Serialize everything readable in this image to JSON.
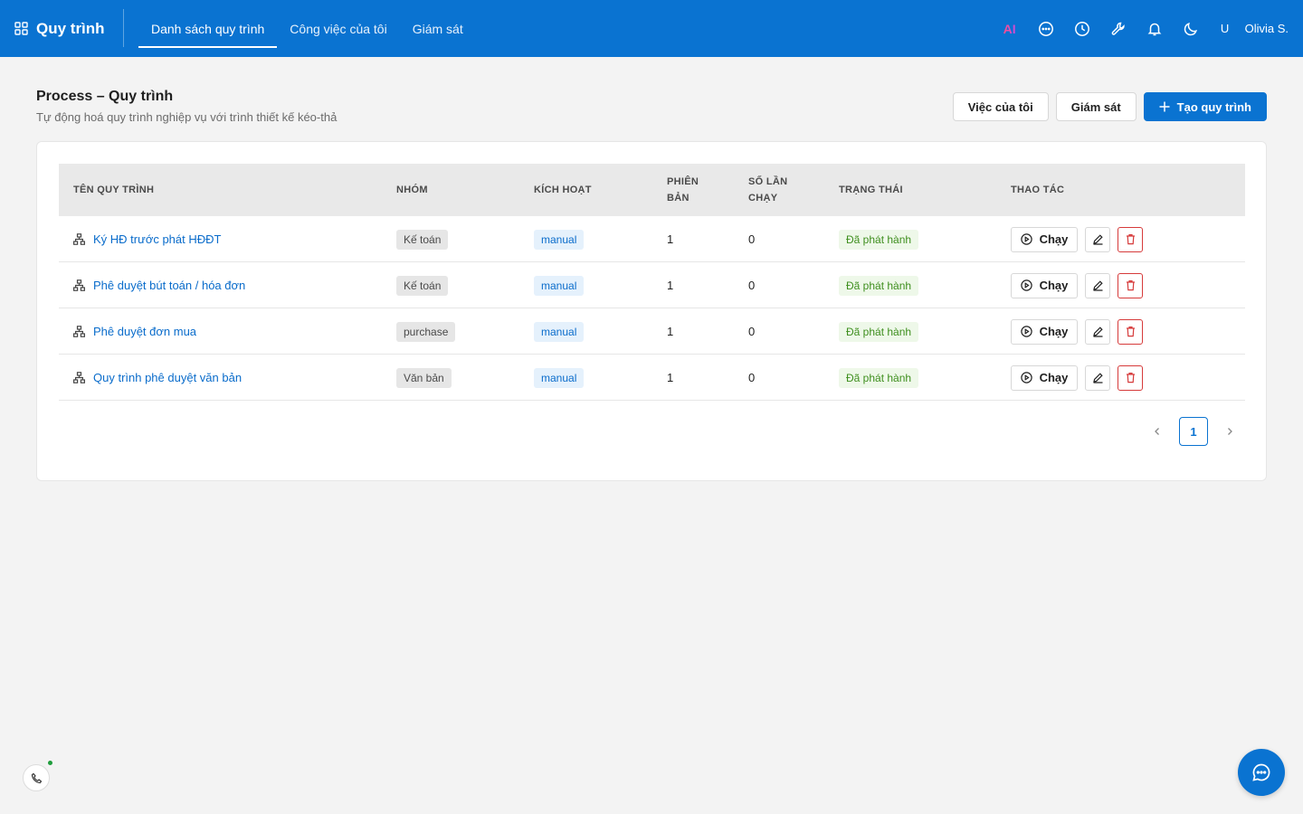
{
  "app": {
    "title": "Quy trình"
  },
  "nav": {
    "tabs": [
      {
        "label": "Danh sách quy trình",
        "active": true
      },
      {
        "label": "Công việc của tôi",
        "active": false
      },
      {
        "label": "Giám sát",
        "active": false
      }
    ]
  },
  "toolbar": {
    "ai_label": "AI",
    "icons": [
      "chat-icon",
      "history-icon",
      "tools-icon",
      "bell-icon",
      "moon-icon"
    ],
    "user_initial": "U",
    "user_name": "Olivia S."
  },
  "page": {
    "title": "Process – Quy trình",
    "subtitle": "Tự động hoá quy trình nghiệp vụ với trình thiết kế kéo-thả"
  },
  "actions": {
    "my_tasks": "Việc của tôi",
    "monitor": "Giám sát",
    "create": "Tạo quy trình"
  },
  "table": {
    "headers": {
      "name": "TÊN QUY TRÌNH",
      "group": "NHÓM",
      "trigger": "KÍCH HOẠT",
      "version_l1": "PHIÊN",
      "version_l2": "BẢN",
      "runs_l1": "SỐ LẦN",
      "runs_l2": "CHẠY",
      "status": "TRẠNG THÁI",
      "actions": "THAO TÁC"
    },
    "rows": [
      {
        "name": "Ký HĐ trước phát HĐĐT",
        "group": "Kế toán",
        "trigger": "manual",
        "version": "1",
        "runs": "0",
        "status": "Đã phát hành",
        "run_label": "Chạy"
      },
      {
        "name": "Phê duyệt bút toán / hóa đơn",
        "group": "Kế toán",
        "trigger": "manual",
        "version": "1",
        "runs": "0",
        "status": "Đã phát hành",
        "run_label": "Chạy"
      },
      {
        "name": "Phê duyệt đơn mua",
        "group": "purchase",
        "trigger": "manual",
        "version": "1",
        "runs": "0",
        "status": "Đã phát hành",
        "run_label": "Chạy"
      },
      {
        "name": "Quy trình phê duyệt văn bản",
        "group": "Văn bản",
        "trigger": "manual",
        "version": "1",
        "runs": "0",
        "status": "Đã phát hành",
        "run_label": "Chạy"
      }
    ]
  },
  "pagination": {
    "current_page": "1"
  },
  "colors": {
    "primary": "#0a73d1",
    "link": "#0a6ccb",
    "danger": "#d63a3a",
    "success": "#3f8f1f"
  }
}
